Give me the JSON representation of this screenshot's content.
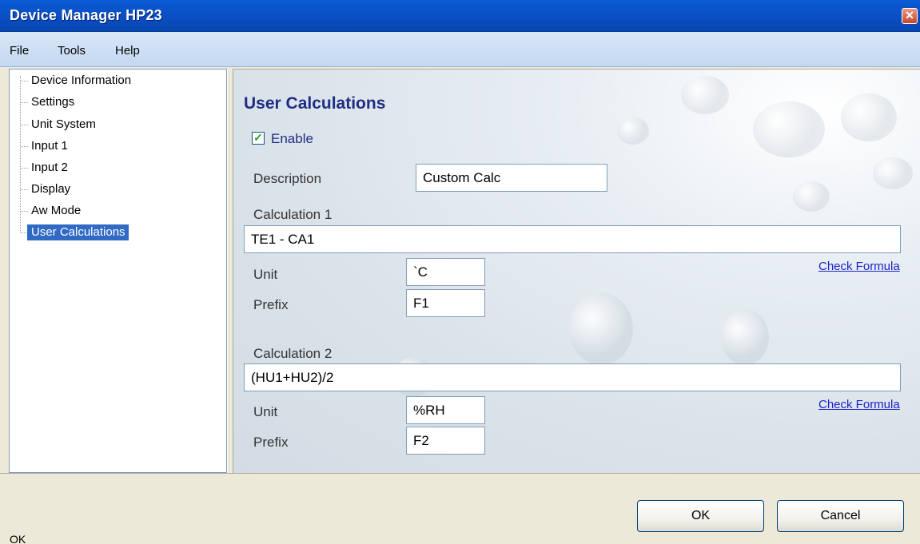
{
  "window": {
    "title": "Device Manager HP23"
  },
  "menu": {
    "items": [
      "File",
      "Tools",
      "Help"
    ]
  },
  "tree": {
    "items": [
      {
        "label": "Device Information"
      },
      {
        "label": "Settings"
      },
      {
        "label": "Unit System"
      },
      {
        "label": "Input 1"
      },
      {
        "label": "Input 2"
      },
      {
        "label": "Display"
      },
      {
        "label": "Aw Mode"
      },
      {
        "label": "User Calculations",
        "selected": true
      }
    ]
  },
  "panel": {
    "title": "User Calculations",
    "enable": {
      "label": "Enable",
      "checked": true
    },
    "description": {
      "label": "Description",
      "value": "Custom Calc"
    },
    "calc1": {
      "label": "Calculation 1",
      "formula": "TE1 - CA1",
      "unit_label": "Unit",
      "unit": "`C",
      "prefix_label": "Prefix",
      "prefix": "F1",
      "check_label": "Check Formula"
    },
    "calc2": {
      "label": "Calculation 2",
      "formula": "(HU1+HU2)/2",
      "unit_label": "Unit",
      "unit": "%RH",
      "prefix_label": "Prefix",
      "prefix": "F2",
      "check_label": "Check Formula"
    }
  },
  "buttons": {
    "ok": "OK",
    "cancel": "Cancel"
  },
  "status": {
    "text": "OK"
  },
  "icons": {
    "close": "close-icon",
    "checkbox": "checkmark-icon"
  },
  "colors": {
    "titlebar": "#0a4fc4",
    "selection": "#316ac5",
    "heading": "#1f2d84",
    "link": "#1a23c8"
  }
}
